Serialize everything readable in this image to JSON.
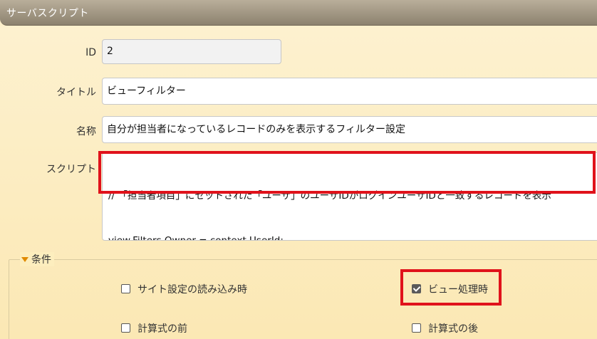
{
  "header": {
    "title": "サーバスクリプト"
  },
  "form": {
    "id": {
      "label": "ID",
      "value": "2"
    },
    "title": {
      "label": "タイトル",
      "value": "ビューフィルター"
    },
    "name": {
      "label": "名称",
      "value": "自分が担当者になっているレコードのみを表示するフィルター設定"
    },
    "script": {
      "label": "スクリプト",
      "line1": "// 「担当者項目」にセットされた「ユーザ」のユーザIDがログインユーザIDと一致するレコードを表示",
      "line2": "view.Filters.Owner = context.UserId;"
    }
  },
  "conditions": {
    "legend": "条件",
    "items": [
      {
        "label": "サイト設定の読み込み時",
        "checked": false
      },
      {
        "label": "ビュー処理時",
        "checked": true
      },
      {
        "label": "計算式の前",
        "checked": false
      },
      {
        "label": "計算式の後",
        "checked": false
      }
    ]
  },
  "colors": {
    "highlight": "#e0121b",
    "accent": "#e08a00",
    "title_bar": "#a59b86"
  }
}
